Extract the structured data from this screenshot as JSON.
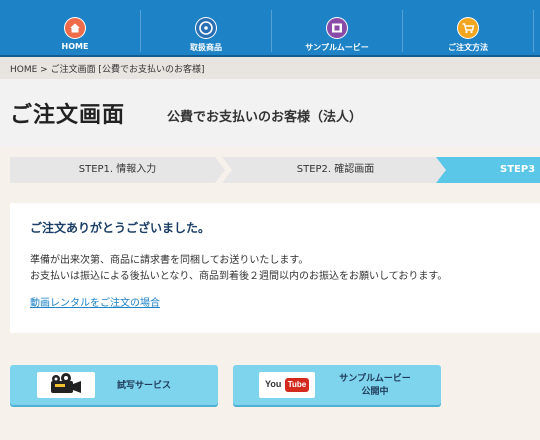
{
  "nav": {
    "items": [
      {
        "label": "HOME",
        "icon": "home-icon",
        "color": "#ef6c4a"
      },
      {
        "label": "取扱商品",
        "icon": "disc-icon",
        "color": "#2a6fb4"
      },
      {
        "label": "サンプルムービー",
        "icon": "film-icon",
        "color": "#8a4aa8"
      },
      {
        "label": "ご注文方法",
        "icon": "cart-icon",
        "color": "#f2a51e"
      }
    ]
  },
  "breadcrumb": "HOME > ご注文画面 [公費でお支払いのお客様]",
  "page": {
    "title": "ご注文画面",
    "subtitle": "公費でお支払いのお客様（法人）"
  },
  "steps": {
    "step1": "STEP1. 情報入力",
    "step2": "STEP2. 確認画面",
    "step3": "STEP3"
  },
  "message": {
    "thanks": "ご注文ありがとうございました。",
    "line1": "準備が出来次第、商品に請求書を同梱してお送りいたします。",
    "line2": "お支払いは振込による後払いとなり、商品到着後２週間以内のお振込をお願いしております。",
    "link": "動画レンタルをご注文の場合"
  },
  "banners": {
    "trial": {
      "label": "試写サービス",
      "icon": "film-camera-icon"
    },
    "sample": {
      "line1": "サンプルムービー",
      "line2": "公開中",
      "logo_left": "You",
      "logo_right": "Tube"
    }
  },
  "colors": {
    "nav_bg": "#1d82c6",
    "active_step": "#5ac7e8",
    "banner_bg": "#7ed4ec",
    "link": "#1d82c6"
  }
}
